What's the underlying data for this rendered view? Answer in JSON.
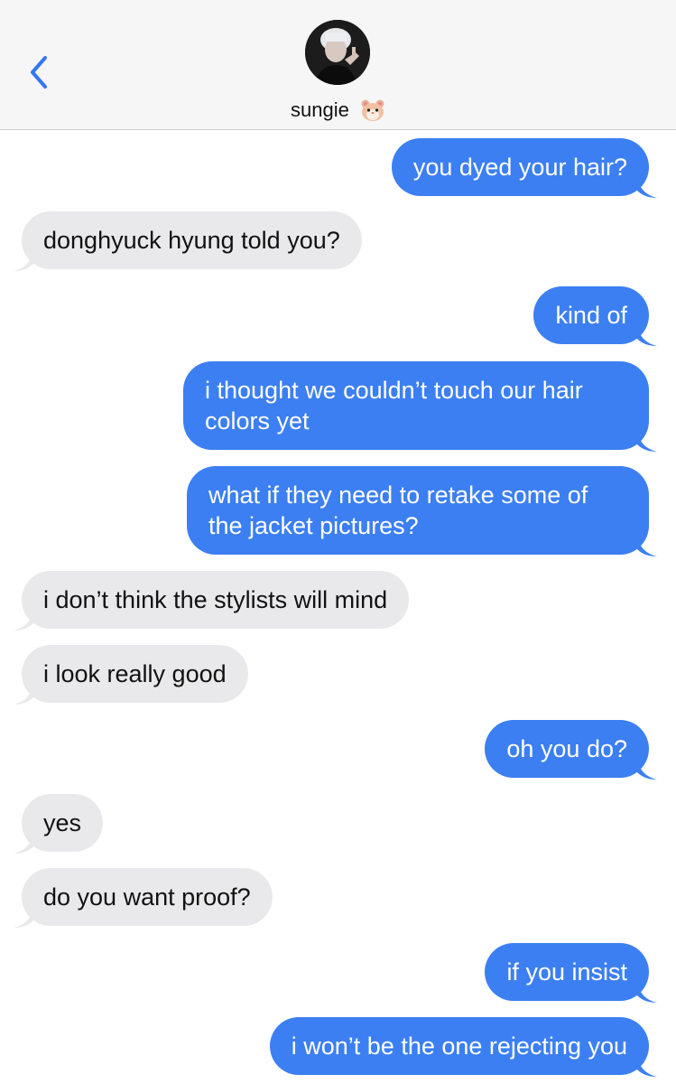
{
  "header": {
    "contact_name": "sungie",
    "contact_emoji": "hamster-face-icon"
  },
  "colors": {
    "outgoing_bubble": "#3c7ff2",
    "incoming_bubble": "#e9e9eb",
    "accent": "#3478f6"
  },
  "messages": [
    {
      "side": "out",
      "text": "you dyed your hair?"
    },
    {
      "side": "in",
      "text": "donghyuck hyung told you?"
    },
    {
      "side": "out",
      "text": "kind of"
    },
    {
      "side": "out",
      "text": "i thought we couldn’t touch our hair colors yet"
    },
    {
      "side": "out",
      "text": "what if they need to retake some of the jacket pictures?"
    },
    {
      "side": "in",
      "text": "i don’t think the stylists will mind"
    },
    {
      "side": "in",
      "text": "i look really good"
    },
    {
      "side": "out",
      "text": "oh you do?"
    },
    {
      "side": "in",
      "text": "yes"
    },
    {
      "side": "in",
      "text": "do you want proof?"
    },
    {
      "side": "out",
      "text": "if you insist"
    },
    {
      "side": "out",
      "text": "i won’t be the one rejecting you"
    }
  ]
}
